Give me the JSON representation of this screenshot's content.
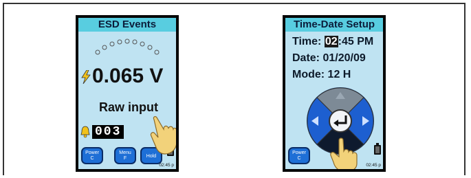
{
  "esd_screen": {
    "title": "ESD Events",
    "value": "0.065 V",
    "subtitle": "Raw input",
    "counter": "003",
    "buttons": [
      {
        "label_line1": "Power",
        "label_line2": "C"
      },
      {
        "label_line1": "Menu",
        "label_line2": "F"
      },
      {
        "label_line1": "Hold",
        "label_line2": ""
      }
    ],
    "clock": "02:45 p"
  },
  "time_screen": {
    "title": "Time-Date Setup",
    "time_label": "Time:",
    "time_hour": "02",
    "time_rest": ":45 PM",
    "date_text": "Date: 01/20/09",
    "mode_text": "Mode: 12 H",
    "button": {
      "label_line1": "Power",
      "label_line2": "C"
    },
    "clock": "02:45 p"
  },
  "colors": {
    "screen_bg": "#bfe3f2",
    "title_bar": "#58cde0",
    "button_blue": "#1e6fd6",
    "dpad_blue": "#1d5fd0"
  }
}
